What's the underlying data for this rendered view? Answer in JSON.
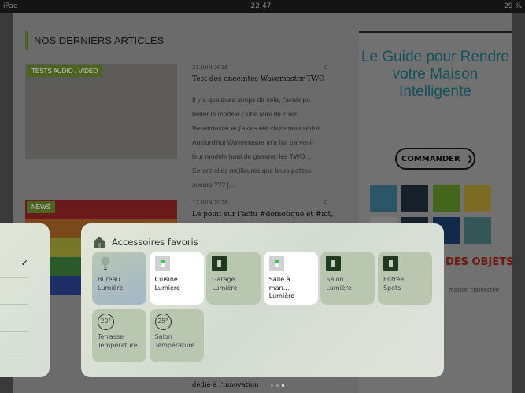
{
  "status": {
    "device": "iPad",
    "time": "22:47",
    "battery": "29 %"
  },
  "site": {
    "section_title": "NOS DERNIERS ARTICLES",
    "articles": [
      {
        "category": "TESTS AUDIO / VIDÉO",
        "date": "21 JUIN 2016",
        "comments": "0",
        "title": "Test des enceintes Wavemaster TWO",
        "excerpt": "Il y a quelques temps de cela, j'avais pu tester le modèle Cube Mini de chez Wavemaster et j'avais été clairement séduit. Aujourd'hui Wavemaster m'a fait parvenir leur modèle haut de gamme: les TWO… Seront-elles meilleures que leurs petites soeurs ??? […"
      },
      {
        "category": "NEWS",
        "date": "17 JUIN 2016",
        "comments": "0",
        "title": "Le point sur l'actu #domotique et #iot,",
        "excerpt": "dédié à l'innovation"
      }
    ],
    "ad": {
      "title": "Le Guide pour Rendre votre Maison Intelligente",
      "cta": "COMMANDER",
      "subtitle": "DES OBJETS",
      "tagline": "maison connectée"
    }
  },
  "widget": {
    "title": "Accessoires favoris",
    "tiles": [
      {
        "name": "Bureau",
        "type": "Lumière",
        "icon": "bulb-icon",
        "on": false
      },
      {
        "name": "Cuisine",
        "type": "Lumière",
        "icon": "switch-icon",
        "on": true
      },
      {
        "name": "Garage",
        "type": "Lumière",
        "icon": "switch-icon",
        "on": false
      },
      {
        "name": "Salle à man…",
        "type": "Lumière",
        "icon": "switch-icon",
        "on": true
      },
      {
        "name": "Salon",
        "type": "Lumière",
        "icon": "switch-icon",
        "on": false
      },
      {
        "name": "Entrée",
        "type": "Spots",
        "icon": "switch-icon",
        "on": false
      },
      {
        "name": "Terrasse",
        "type": "Température",
        "icon": "thermometer-icon",
        "value": "20°"
      },
      {
        "name": "Salon",
        "type": "Température",
        "icon": "thermometer-icon",
        "value": "25°"
      }
    ],
    "page_count": 3,
    "current_page": 3
  }
}
